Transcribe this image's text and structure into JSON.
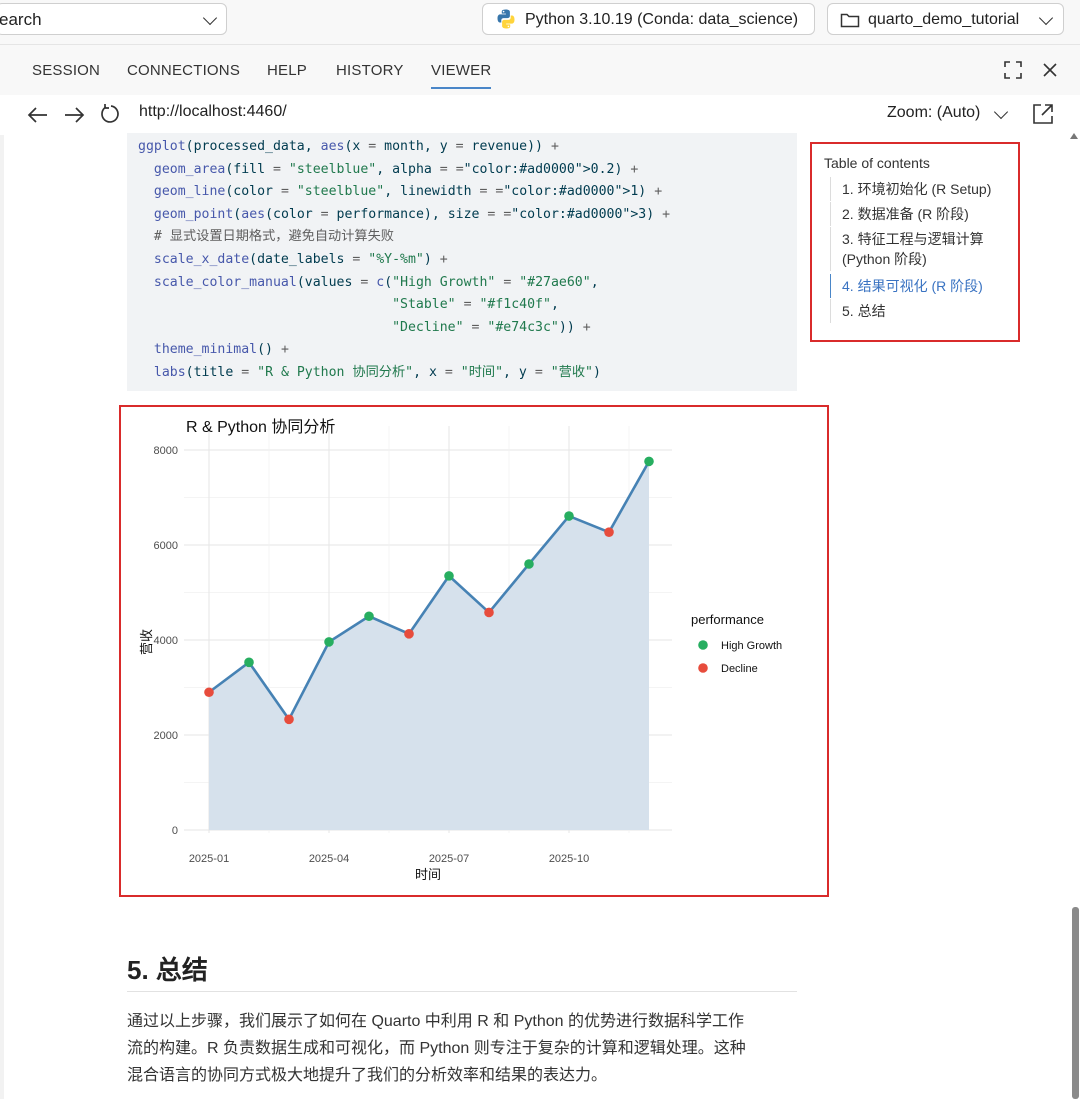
{
  "topbar": {
    "search_text": "earch",
    "python_env": "Python 3.10.19 (Conda: data_science)",
    "project": "quarto_demo_tutorial"
  },
  "tabs": [
    "SESSION",
    "CONNECTIONS",
    "HELP",
    "HISTORY",
    "VIEWER"
  ],
  "address": {
    "url": "http://localhost:4460/",
    "zoom": "Zoom: (Auto)"
  },
  "code_lines": [
    "ggplot(processed_data, aes(x = month, y = revenue)) +",
    "  geom_area(fill = \"steelblue\", alpha = 0.2) +",
    "  geom_line(color = \"steelblue\", linewidth = 1) +",
    "  geom_point(aes(color = performance), size = 3) +",
    "  # 显式设置日期格式，避免自动计算失败",
    "  scale_x_date(date_labels = \"%Y-%m\") +",
    "  scale_color_manual(values = c(\"High Growth\" = \"#27ae60\",",
    "                                \"Stable\" = \"#f1c40f\",",
    "                                \"Decline\" = \"#e74c3c\")) +",
    "  theme_minimal() +",
    "  labs(title = \"R & Python 协同分析\", x = \"时间\", y = \"营收\")"
  ],
  "toc": {
    "title": "Table of contents",
    "items": [
      "1. 环境初始化 (R Setup)",
      "2. 数据准备 (R 阶段)",
      "3. 特征工程与逻辑计算 (Python 阶段)",
      "4. 结果可视化 (R 阶段)",
      "5. 总结"
    ],
    "active_index": 3
  },
  "chart_data": {
    "type": "area",
    "title": "R & Python 协同分析",
    "xlabel": "时间",
    "ylabel": "营收",
    "ylim": [
      0,
      8000
    ],
    "yticks": [
      0,
      2000,
      4000,
      6000,
      8000
    ],
    "xticks": [
      "2025-01",
      "2025-04",
      "2025-07",
      "2025-10"
    ],
    "x": [
      "2025-01",
      "2025-02",
      "2025-03",
      "2025-04",
      "2025-05",
      "2025-06",
      "2025-07",
      "2025-08",
      "2025-09",
      "2025-10",
      "2025-11",
      "2025-12"
    ],
    "values": [
      2900,
      3530,
      2330,
      3960,
      4500,
      4130,
      5350,
      4580,
      5600,
      6610,
      6270,
      7760
    ],
    "performance": [
      "Decline",
      "High Growth",
      "Decline",
      "High Growth",
      "High Growth",
      "Decline",
      "High Growth",
      "Decline",
      "High Growth",
      "High Growth",
      "Decline",
      "High Growth"
    ],
    "legend_title": "performance",
    "legend": [
      {
        "name": "High Growth",
        "color": "#27ae60"
      },
      {
        "name": "Decline",
        "color": "#e74c3c"
      }
    ],
    "line_color": "#4682b4",
    "fill_color": "#d6e1ec",
    "grid": true,
    "legend_position": "right"
  },
  "summary": {
    "heading": "5. 总结",
    "lines": [
      "通过以上步骤，我们展示了如何在 Quarto 中利用 R 和 Python 的优势进行数据科学工作",
      "流的构建。R 负责数据生成和可视化，而 Python 则专注于复杂的计算和逻辑处理。这种",
      "混合语言的协同方式极大地提升了我们的分析效率和结果的表达力。"
    ]
  }
}
